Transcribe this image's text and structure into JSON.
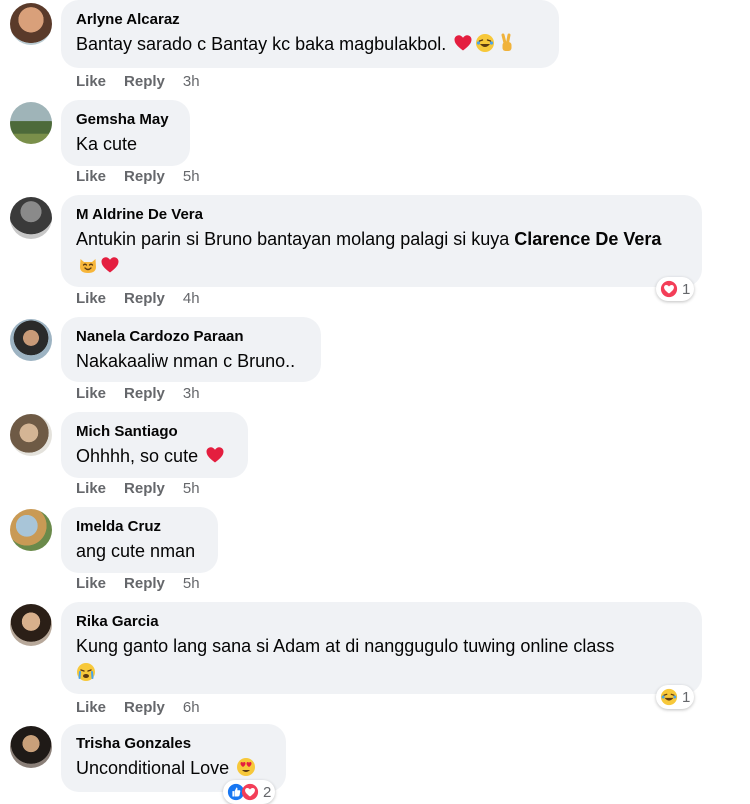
{
  "actions": {
    "like": "Like",
    "reply": "Reply"
  },
  "comments": [
    {
      "author": "Arlyne Alcaraz",
      "text": "Bantay sarado c Bantay kc baka magbulakbol.",
      "time": "3h"
    },
    {
      "author": "Gemsha May",
      "text": "Ka cute",
      "time": "5h"
    },
    {
      "author": "M Aldrine De Vera",
      "text1": "Antukin parin si Bruno bantayan molang palagi si kuya ",
      "mention": "Clarence De Vera",
      "time": "4h",
      "reaction_count": "1"
    },
    {
      "author": "Nanela Cardozo Paraan",
      "text": "Nakakaaliw nman c Bruno..",
      "time": "3h"
    },
    {
      "author": "Mich Santiago",
      "text": "Ohhhh, so cute",
      "time": "5h"
    },
    {
      "author": "Imelda Cruz",
      "text": "ang cute nman",
      "time": "5h"
    },
    {
      "author": "Rika Garcia",
      "text": "Kung ganto lang sana si Adam at di nanggugulo tuwing online class",
      "time": "6h",
      "reaction_count": "1"
    },
    {
      "author": "Trisha Gonzales",
      "text": "Unconditional Love",
      "reaction_count": "2"
    }
  ],
  "colors": {
    "bubble": "#f0f2f5",
    "meta": "#65676b",
    "text": "#050505",
    "heart": "#e41e3f"
  }
}
